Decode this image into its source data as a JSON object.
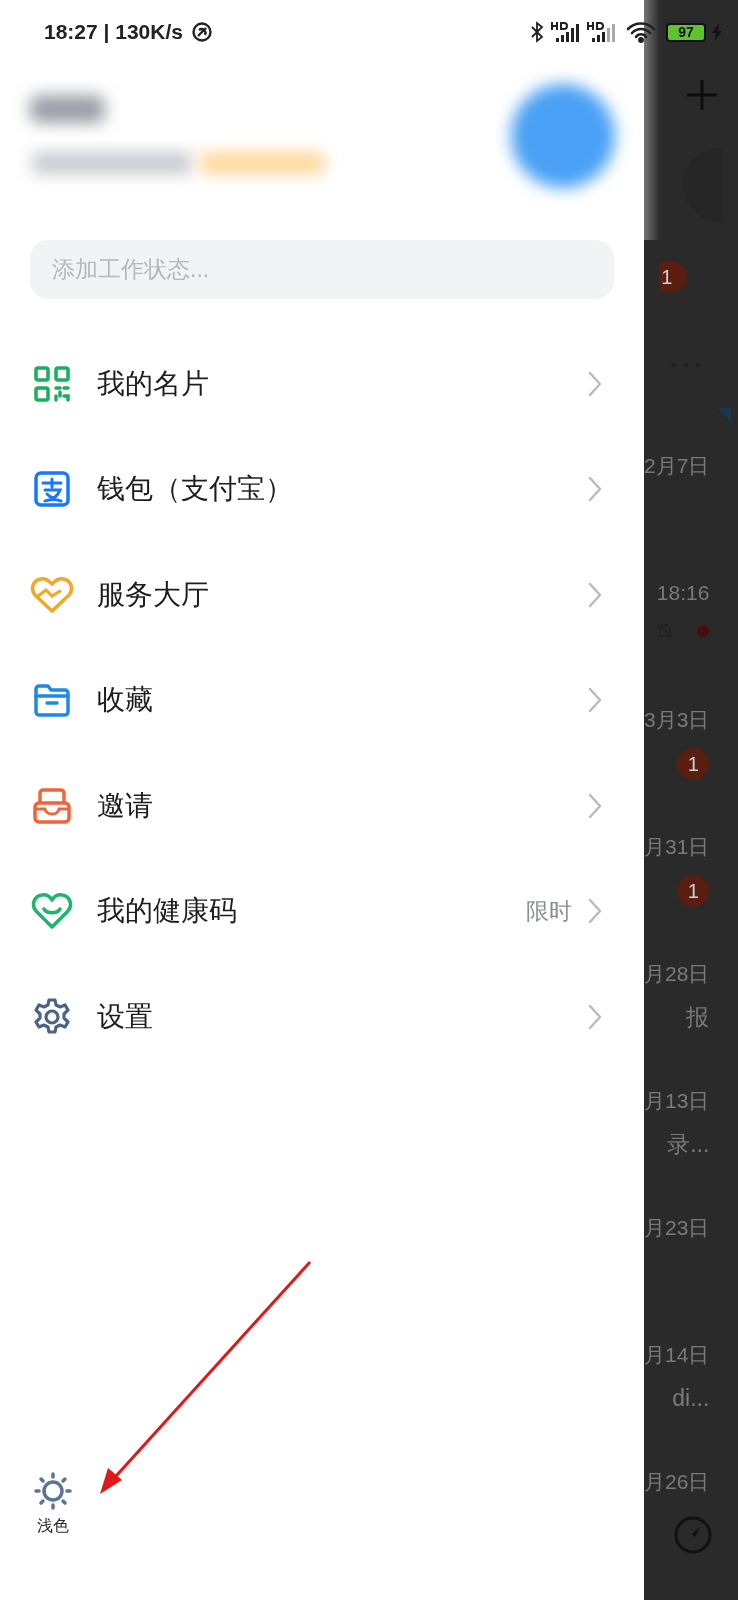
{
  "status_bar": {
    "time_speed": "18:27 | 130K/s",
    "battery": "97"
  },
  "status_field": {
    "placeholder": "添加工作状态..."
  },
  "menu": [
    {
      "kind": "qr",
      "label": "我的名片"
    },
    {
      "kind": "wallet",
      "label": "钱包（支付宝）"
    },
    {
      "kind": "service",
      "label": "服务大厅"
    },
    {
      "kind": "folder",
      "label": "收藏"
    },
    {
      "kind": "invite",
      "label": "邀请"
    },
    {
      "kind": "health",
      "label": "我的健康码",
      "badge": "限时"
    },
    {
      "kind": "settings",
      "label": "设置"
    }
  ],
  "theme_toggle": {
    "label": "浅色"
  },
  "background_list": {
    "top_badge": "1",
    "rows": [
      {
        "time": "2月7日"
      },
      {
        "time": "18:16",
        "muted": true,
        "unread_dot": true
      },
      {
        "time": "3月3日",
        "badge": "1"
      },
      {
        "time": "月31日",
        "badge": "1"
      },
      {
        "time": "月28日",
        "preview": "报"
      },
      {
        "time": "月13日",
        "preview": "录..."
      },
      {
        "time": "月23日"
      },
      {
        "time": "月14日",
        "preview": "di..."
      },
      {
        "time": "月26日"
      }
    ]
  }
}
